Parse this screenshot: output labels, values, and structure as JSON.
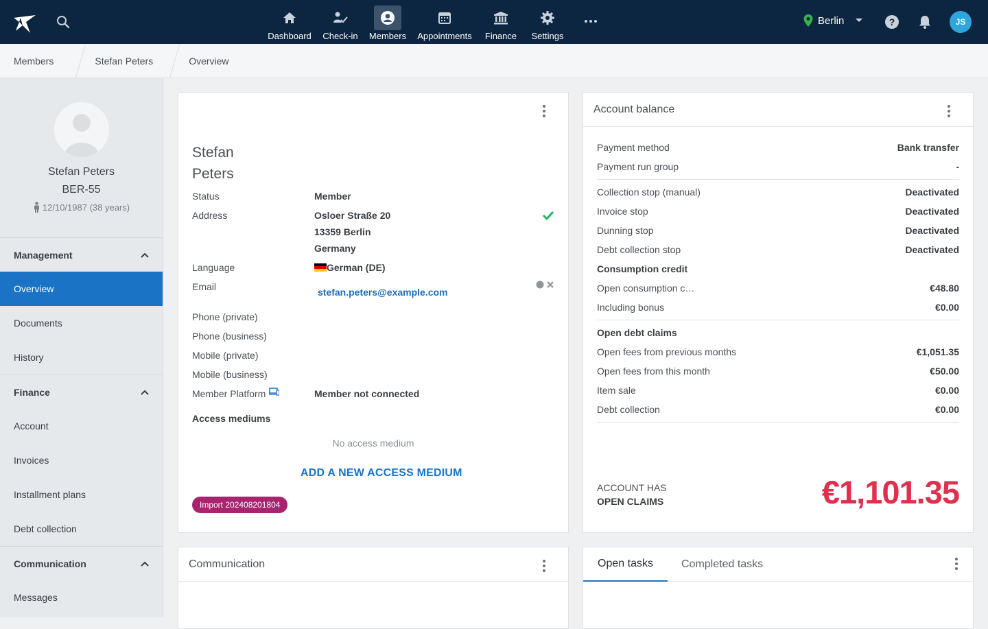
{
  "nav": {
    "items": [
      {
        "label": "Dashboard",
        "icon": "home-icon"
      },
      {
        "label": "Check-in",
        "icon": "check-in-icon"
      },
      {
        "label": "Members",
        "icon": "members-icon"
      },
      {
        "label": "Appointments",
        "icon": "calendar-icon"
      },
      {
        "label": "Finance",
        "icon": "bank-icon"
      },
      {
        "label": "Settings",
        "icon": "gear-icon"
      }
    ],
    "active": "Members",
    "location": "Berlin",
    "user_initials": "JS"
  },
  "breadcrumb": [
    "Members",
    "Stefan Peters",
    "Overview"
  ],
  "profile": {
    "name": "Stefan Peters",
    "member_id": "BER-55",
    "dob": "12/10/1987 (38 years)"
  },
  "sidebar": {
    "sections": [
      {
        "title": "Management",
        "items": [
          "Overview",
          "Documents",
          "History"
        ]
      },
      {
        "title": "Finance",
        "items": [
          "Account",
          "Invoices",
          "Installment plans",
          "Debt collection"
        ]
      },
      {
        "title": "Communication",
        "items": [
          "Messages"
        ]
      }
    ],
    "active_item": "Overview"
  },
  "member": {
    "first_name": "Stefan",
    "last_name": "Peters",
    "labels": {
      "status": "Status",
      "address": "Address",
      "language": "Language",
      "email": "Email",
      "phone_private": "Phone (private)",
      "phone_business": "Phone (business)",
      "mobile_private": "Mobile (private)",
      "mobile_business": "Mobile (business)",
      "member_platform": "Member Platform",
      "access_mediums": "Access mediums"
    },
    "status": "Member",
    "address_line1": "Osloer Straße 20",
    "address_line2": "13359 Berlin",
    "address_line3": "Germany",
    "language": "German (DE)",
    "email": "stefan.peters@example.com",
    "member_platform": "Member not connected",
    "no_access_medium": "No access medium",
    "add_access_medium": "ADD A NEW ACCESS MEDIUM",
    "tag": "Import 202408201804"
  },
  "account_balance": {
    "title": "Account balance",
    "payment_method_label": "Payment method",
    "payment_method": "Bank transfer",
    "payment_run_group_label": "Payment run group",
    "payment_run_group": "-",
    "stops": [
      {
        "label": "Collection stop (manual)",
        "value": "Deactivated"
      },
      {
        "label": "Invoice stop",
        "value": "Deactivated"
      },
      {
        "label": "Dunning stop",
        "value": "Deactivated"
      },
      {
        "label": "Debt collection stop",
        "value": "Deactivated"
      }
    ],
    "consumption_title": "Consumption credit",
    "consumption": [
      {
        "label": "Open consumption c…",
        "value": "€48.80"
      },
      {
        "label": "Including bonus",
        "value": "€0.00"
      }
    ],
    "debt_title": "Open debt claims",
    "debt": [
      {
        "label": "Open fees from previous months",
        "value": "€1,051.35"
      },
      {
        "label": "Open fees from this month",
        "value": "€50.00"
      },
      {
        "label": "Item sale",
        "value": "€0.00"
      },
      {
        "label": "Debt collection",
        "value": "€0.00"
      }
    ],
    "claims_line1": "ACCOUNT HAS",
    "claims_line2": "OPEN CLAIMS",
    "total": "€1,101.35"
  },
  "communication": {
    "title": "Communication"
  },
  "tasks": {
    "open_tab": "Open tasks",
    "completed_tab": "Completed tasks"
  },
  "colors": {
    "topbar": "#0c2540",
    "accent": "#1a73c5",
    "total": "#e0304f",
    "tag": "#a8246e",
    "check": "#22b55a"
  }
}
